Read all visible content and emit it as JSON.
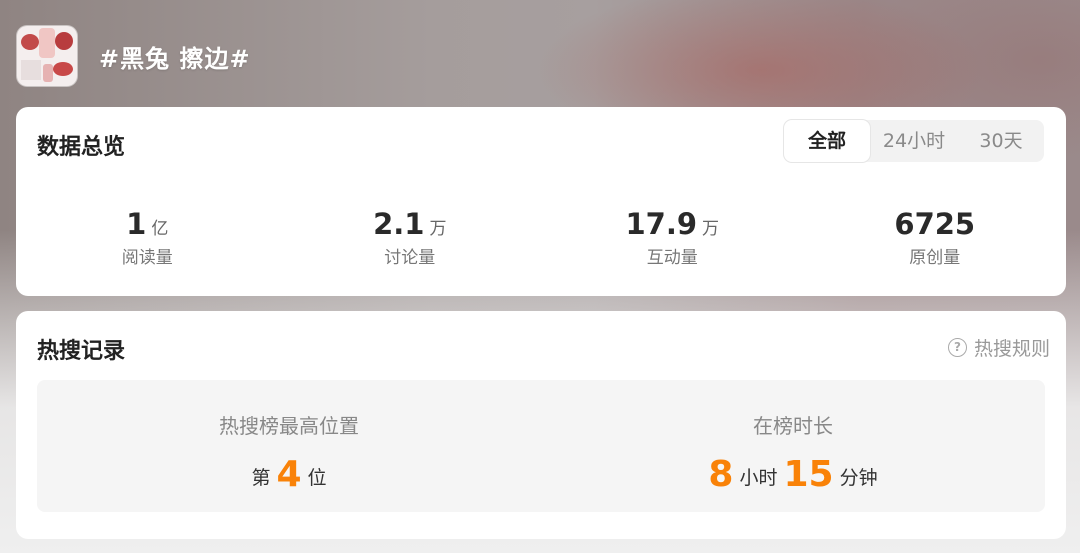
{
  "topic": {
    "title": "#黑兔 擦边#"
  },
  "overview": {
    "title": "数据总览",
    "tabs": [
      "全部",
      "24小时",
      "30天"
    ],
    "active_tab": "全部",
    "stats": [
      {
        "value": "1",
        "unit": "亿",
        "label": "阅读量"
      },
      {
        "value": "2.1",
        "unit": "万",
        "label": "讨论量"
      },
      {
        "value": "17.9",
        "unit": "万",
        "label": "互动量"
      },
      {
        "value": "6725",
        "unit": "",
        "label": "原创量"
      }
    ]
  },
  "hot_search": {
    "title": "热搜记录",
    "rules_link": "热搜规则",
    "highest_position": {
      "label": "热搜榜最高位置",
      "prefix": "第",
      "value": "4",
      "suffix": "位"
    },
    "duration": {
      "label": "在榜时长",
      "hours": "8",
      "hours_unit": "小时",
      "minutes": "15",
      "minutes_unit": "分钟"
    }
  },
  "colors": {
    "accent": "#f98208"
  }
}
